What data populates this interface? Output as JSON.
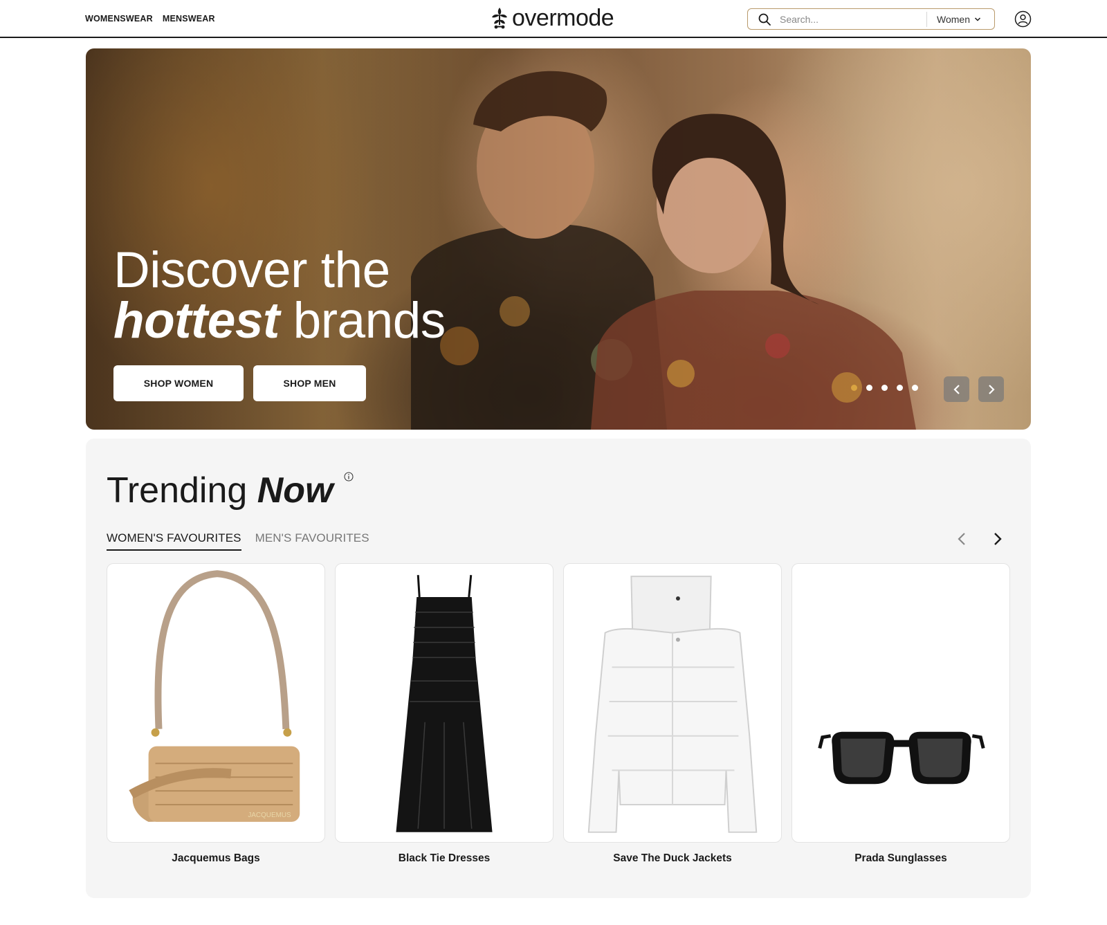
{
  "header": {
    "nav": [
      "WOMENSWEAR",
      "MENSWEAR"
    ],
    "brand": "overmode",
    "search_placeholder": "Search...",
    "gender_selected": "Women"
  },
  "hero": {
    "title_line1": "Discover the",
    "title_em": "hottest",
    "title_rest": " brands",
    "buttons": [
      "SHOP WOMEN",
      "SHOP MEN"
    ],
    "slide_count": 5,
    "active_slide": 1
  },
  "trending": {
    "title": "Trending ",
    "title_em": "Now",
    "tabs": [
      "WOMEN'S FAVOURITES",
      "MEN'S FAVOURITES"
    ],
    "active_tab": 0,
    "items": [
      {
        "label": "Jacquemus Bags",
        "icon": "handbag-icon",
        "brand_print": "JACQUEMUS"
      },
      {
        "label": "Black Tie Dresses",
        "icon": "dress-icon"
      },
      {
        "label": "Save The Duck Jackets",
        "icon": "puffer-jacket-icon"
      },
      {
        "label": "Prada Sunglasses",
        "icon": "sunglasses-icon"
      }
    ]
  },
  "colors": {
    "accent": "#b99a6b",
    "active_dot": "#d9a441",
    "section_bg": "#f5f5f5"
  }
}
